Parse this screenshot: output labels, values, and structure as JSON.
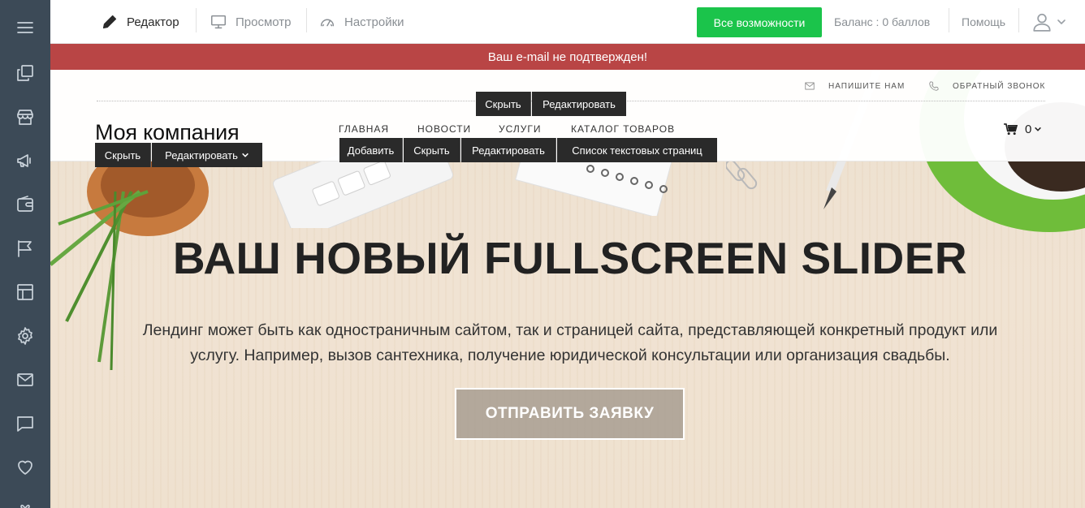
{
  "toolbar": {
    "editor": "Редактор",
    "preview": "Просмотр",
    "settings": "Настройки",
    "all_features": "Все возможности",
    "balance": "Баланс : 0 баллов",
    "help": "Помощь"
  },
  "alert": {
    "text": "Ваш e-mail не подтвержден!"
  },
  "site": {
    "contacts": {
      "write_us": "НАПИШИТЕ НАМ",
      "callback": "ОБРАТНЫЙ ЗВОНОК"
    },
    "logo": "Моя компания",
    "nav": [
      "ГЛАВНАЯ",
      "НОВОСТИ",
      "УСЛУГИ",
      "КАТАЛОГ ТОВАРОВ"
    ],
    "cart_count": "0"
  },
  "controls": {
    "hide": "Скрыть",
    "edit": "Редактировать",
    "add": "Добавить",
    "text_pages": "Список текстовых страниц"
  },
  "hero": {
    "title": "ВАШ НОВЫЙ FULLSCREEN SLIDER",
    "text_line1": "Лендинг может быть как одностраничным сайтом, так и страницей сайта, представляющей конкретный продукт или",
    "text_line2": "услугу. Например, вызов сантехника, получение юридической консультации или организация свадьбы.",
    "button": "ОТПРАВИТЬ ЗАЯВКУ"
  },
  "colors": {
    "sidebar": "#3c4a57",
    "accent_green": "#1bc44b",
    "alert_red": "#b94545"
  },
  "sidebar_icons": [
    "menu-icon",
    "pages-icon",
    "store-icon",
    "promo-icon",
    "wallet-icon",
    "flag-icon",
    "layout-icon",
    "gear-icon",
    "mail-icon",
    "chat-icon",
    "heart-icon",
    "gift-icon"
  ]
}
